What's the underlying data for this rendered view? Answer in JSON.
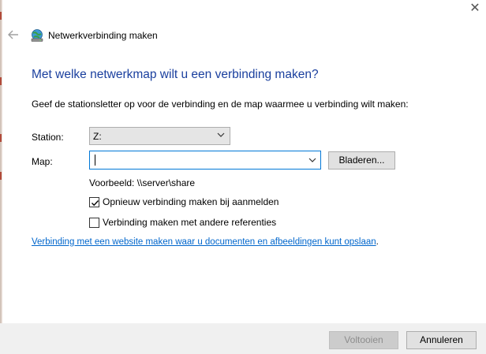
{
  "window": {
    "title": "Netwerkverbinding maken",
    "back_icon": "arrow-left-icon",
    "app_icon": "network-drive-icon",
    "close_glyph": "✕"
  },
  "main": {
    "heading": "Met welke netwerkmap wilt u een verbinding maken?",
    "instruction": "Geef de stationsletter op voor de verbinding en de map waarmee u verbinding wilt maken:",
    "station": {
      "label": "Station:",
      "value": "Z:"
    },
    "map": {
      "label": "Map:",
      "value": ""
    },
    "browse_label": "Bladeren...",
    "example": "Voorbeeld: \\\\server\\share",
    "reconnect": {
      "label": "Opnieuw verbinding maken bij aanmelden",
      "checked": true
    },
    "other_credentials": {
      "label": "Verbinding maken met andere referenties",
      "checked": false
    },
    "website_link": "Verbinding met een website maken waar u documenten en afbeeldingen kunt opslaan",
    "website_link_suffix": "."
  },
  "footer": {
    "finish_label": "Voltooien",
    "cancel_label": "Annuleren"
  },
  "colors": {
    "heading": "#1a3f9e",
    "link": "#0066cc",
    "focus_border": "#0078d7",
    "footer_bg": "#f0f0f0"
  }
}
